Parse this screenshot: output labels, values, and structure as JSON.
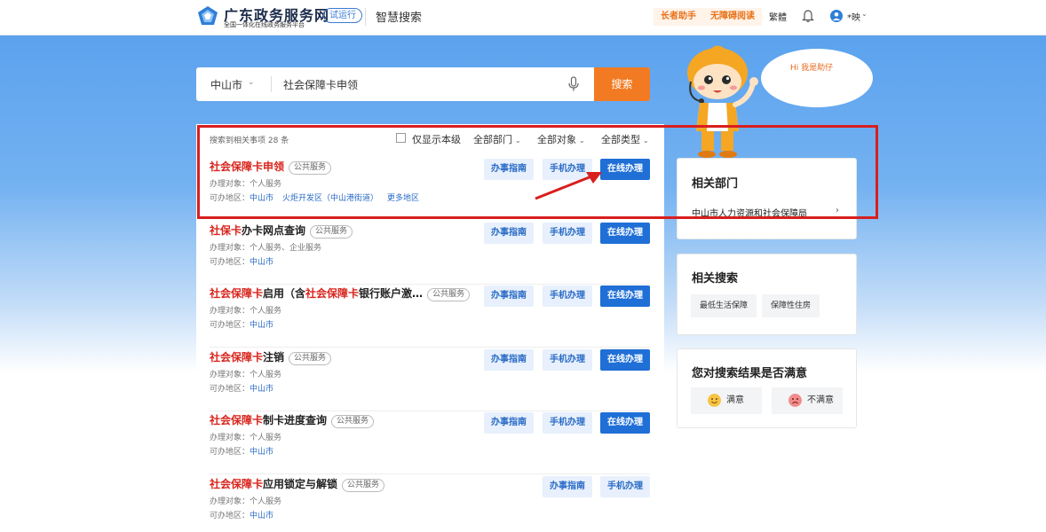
{
  "header": {
    "logo_title": "广东政务服务网",
    "logo_subtitle": "全国一体化在线政务服务平台",
    "trial_badge": "试运行",
    "section_title": "智慧搜索",
    "elder_helper": "长者助手",
    "accessible_reading": "无障碍阅读",
    "traditional": "繁體",
    "user_name": "*映"
  },
  "search": {
    "city": "中山市",
    "query": "社会保障卡申领",
    "button": "搜索"
  },
  "mascot": {
    "bubble_text": "Hi 我是助仔"
  },
  "filters": {
    "count_prefix": "搜索到相关事项",
    "count": "28",
    "count_suffix": "条",
    "only_this_level": "仅显示本级",
    "dept": "全部部门",
    "target": "全部对象",
    "type": "全部类型"
  },
  "labels": {
    "target_prefix": "办理对象：",
    "area_prefix": "可办地区：",
    "guide": "办事指南",
    "mobile": "手机办理",
    "online": "在线办理"
  },
  "results": [
    {
      "title_hl": "社会保障卡申领",
      "title_rest": "",
      "title_hl2": "",
      "title_rest2": "",
      "tag": "公共服务",
      "target": "个人服务",
      "areas": [
        "中山市",
        "火炬开发区（中山港街道）",
        "更多地区"
      ],
      "online": true
    },
    {
      "title_hl": "社保卡",
      "title_rest": "办卡网点查询",
      "title_hl2": "",
      "title_rest2": "",
      "tag": "公共服务",
      "target": "个人服务、企业服务",
      "areas": [
        "中山市"
      ],
      "online": true
    },
    {
      "title_hl": "社会保障卡",
      "title_rest": "启用（含",
      "title_hl2": "社会保障卡",
      "title_rest2": "银行账户激…",
      "tag": "公共服务",
      "target": "个人服务",
      "areas": [
        "中山市"
      ],
      "online": true
    },
    {
      "title_hl": "社会保障卡",
      "title_rest": "注销",
      "title_hl2": "",
      "title_rest2": "",
      "tag": "公共服务",
      "target": "个人服务",
      "areas": [
        "中山市"
      ],
      "online": true
    },
    {
      "title_hl": "社会保障卡",
      "title_rest": "制卡进度查询",
      "title_hl2": "",
      "title_rest2": "",
      "tag": "公共服务",
      "target": "个人服务",
      "areas": [
        "中山市"
      ],
      "online": true
    },
    {
      "title_hl": "社会保障卡",
      "title_rest": "应用锁定与解锁",
      "title_hl2": "",
      "title_rest2": "",
      "tag": "公共服务",
      "target": "个人服务",
      "areas": [
        "中山市"
      ],
      "online": false
    }
  ],
  "sidebar": {
    "related_dept_title": "相关部门",
    "related_dept": "中山市人力资源和社会保障局",
    "related_search_title": "相关搜索",
    "related_searches": [
      "最低生活保障",
      "保障性住房"
    ],
    "satisfaction_title": "您对搜索结果是否满意",
    "satisfied": "满意",
    "unsatisfied": "不满意"
  },
  "colors": {
    "accent_orange": "#f27a22",
    "primary_blue": "#1f6fd6",
    "highlight_red": "#d9251d",
    "annotation_red": "#d91e1e"
  }
}
